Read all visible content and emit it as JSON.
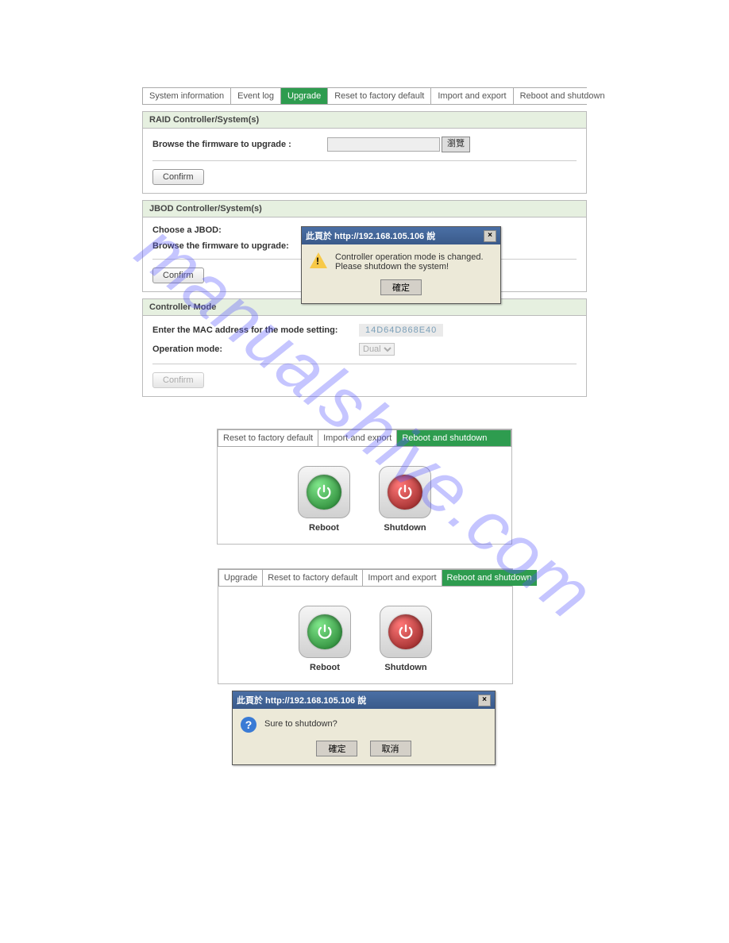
{
  "watermark": "manualshive.com",
  "section1": {
    "tabs": {
      "system_information": "System information",
      "event_log": "Event log",
      "upgrade": "Upgrade",
      "reset": "Reset to factory default",
      "import_export": "Import and export",
      "reboot_shutdown": "Reboot and shutdown"
    },
    "raid": {
      "title": "RAID Controller/System(s)",
      "browse_label": "Browse the firmware to upgrade :",
      "file_btn": "瀏覽",
      "confirm": "Confirm"
    },
    "jbod": {
      "title": "JBOD Controller/System(s)",
      "choose_label": "Choose a JBOD:",
      "browse_label": "Browse the firmware to upgrade:",
      "confirm": "Confirm"
    },
    "controller_mode": {
      "title": "Controller Mode",
      "mac_label": "Enter the MAC address for the mode setting:",
      "mac_value": "14D64D868E40",
      "operation_label": "Operation mode:",
      "operation_value": "Dual",
      "confirm": "Confirm"
    },
    "dialog": {
      "title": "此頁於 http://192.168.105.106 說",
      "msg1": "Controller operation mode is changed.",
      "msg2": "Please shutdown the system!",
      "ok": "確定"
    }
  },
  "section2": {
    "tabs": {
      "reset": "Reset to factory default",
      "import_export": "Import and export",
      "reboot_shutdown": "Reboot and shutdown"
    },
    "reboot": "Reboot",
    "shutdown": "Shutdown"
  },
  "section3": {
    "tabs": {
      "upgrade": "Upgrade",
      "reset": "Reset to factory default",
      "import_export": "Import and export",
      "reboot_shutdown": "Reboot and shutdown"
    },
    "reboot": "Reboot",
    "shutdown": "Shutdown",
    "dialog": {
      "title": "此頁於 http://192.168.105.106 說",
      "msg": "Sure to shutdown?",
      "ok": "確定",
      "cancel": "取消"
    }
  }
}
